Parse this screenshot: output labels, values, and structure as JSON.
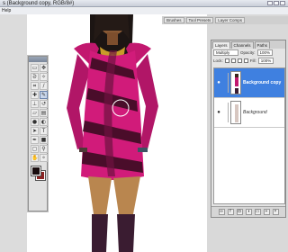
{
  "window": {
    "title": "s (Background copy, RGB/8#)",
    "menu_fragment": "Help"
  },
  "palette_well": {
    "tabs": [
      "Brushes",
      "Tool Presets",
      "Layer Comps"
    ]
  },
  "layers_panel": {
    "tabs": [
      "Layers",
      "Channels",
      "Paths"
    ],
    "blend_mode": "Multiply",
    "opacity_label": "Opacity:",
    "opacity_value": "100%",
    "lock_label": "Lock:",
    "fill_label": "Fill:",
    "fill_value": "100%",
    "layers": [
      {
        "name": "Background copy",
        "selected": true
      },
      {
        "name": "Background",
        "selected": false
      }
    ]
  },
  "toolbox": {
    "tools": [
      "marquee-icon",
      "move-icon",
      "lasso-icon",
      "magic-wand-icon",
      "crop-icon",
      "slice-icon",
      "healing-icon",
      "brush-icon",
      "stamp-icon",
      "history-brush-icon",
      "eraser-icon",
      "gradient-icon",
      "blur-icon",
      "dodge-icon",
      "path-select-icon",
      "type-icon",
      "pen-icon",
      "shape-icon",
      "notes-icon",
      "eyedropper-icon",
      "hand-icon",
      "zoom-icon"
    ],
    "foreground_color": "#1a0e10",
    "background_color": "#8a2323"
  }
}
